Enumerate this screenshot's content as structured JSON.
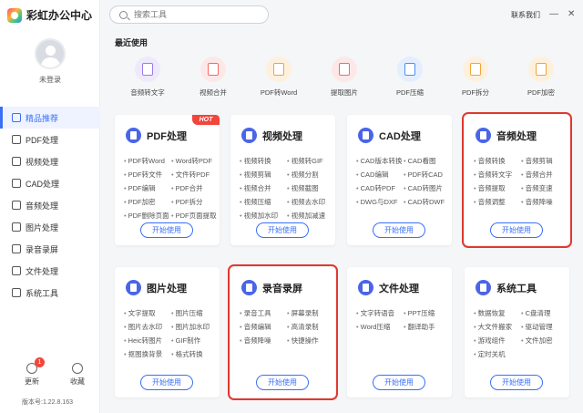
{
  "app": {
    "title": "彩虹办公中心",
    "version": "版本号:1.22.8.163"
  },
  "user": {
    "login_label": "未登录"
  },
  "search": {
    "placeholder": "搜索工具"
  },
  "header": {
    "contact": "联系我们",
    "minimize": "—",
    "close": "✕"
  },
  "sidebar": {
    "items": [
      {
        "label": "精品推荐",
        "icon": "thumbs-up-icon"
      },
      {
        "label": "PDF处理",
        "icon": "pdf-icon"
      },
      {
        "label": "视频处理",
        "icon": "video-icon"
      },
      {
        "label": "CAD处理",
        "icon": "cad-icon"
      },
      {
        "label": "音频处理",
        "icon": "music-icon"
      },
      {
        "label": "图片处理",
        "icon": "image-icon"
      },
      {
        "label": "录音录屏",
        "icon": "microphone-icon"
      },
      {
        "label": "文件处理",
        "icon": "folder-icon"
      },
      {
        "label": "系统工具",
        "icon": "monitor-icon"
      }
    ],
    "footer": {
      "update_label": "更新",
      "update_badge": "1",
      "favorite_label": "收藏"
    }
  },
  "recent": {
    "title": "最近使用",
    "items": [
      {
        "label": "音频转文字",
        "color": "#9b7bea",
        "bg": "#efe9fc"
      },
      {
        "label": "视频合并",
        "color": "#f06a6a",
        "bg": "#fde8e8"
      },
      {
        "label": "PDF转Word",
        "color": "#f0a43a",
        "bg": "#fdf1de"
      },
      {
        "label": "提取图片",
        "color": "#f06a6a",
        "bg": "#fde8e8"
      },
      {
        "label": "PDF压缩",
        "color": "#4a8ff0",
        "bg": "#e3efff"
      },
      {
        "label": "PDF拆分",
        "color": "#f0a43a",
        "bg": "#fdf1de"
      },
      {
        "label": "PDF加密",
        "color": "#f0a43a",
        "bg": "#fdf1de"
      }
    ]
  },
  "cards": [
    {
      "title": "PDF处理",
      "hot": "HOT",
      "button": "开始使用",
      "items": [
        "PDF转Word",
        "Word转PDF",
        "PDF转文件",
        "文件转PDF",
        "PDF编辑",
        "PDF合并",
        "PDF加密",
        "PDF拆分",
        "PDF删除页面",
        "PDF页面提取"
      ]
    },
    {
      "title": "视频处理",
      "button": "开始使用",
      "items": [
        "视频转换",
        "视频转GIF",
        "视频剪辑",
        "视频分割",
        "视频合并",
        "视频截图",
        "视频压缩",
        "视频去水印",
        "视频加水印",
        "视频加减速"
      ]
    },
    {
      "title": "CAD处理",
      "button": "开始使用",
      "items": [
        "CAD版本转换",
        "CAD看图",
        "CAD编辑",
        "PDF转CAD",
        "CAD转PDF",
        "CAD转图片",
        "DWG与DXF",
        "CAD转DWF"
      ]
    },
    {
      "title": "音频处理",
      "button": "开始使用",
      "items": [
        "音频转换",
        "音频剪辑",
        "音频转文字",
        "音频合并",
        "音频提取",
        "音频变速",
        "音频调整",
        "音频降噪"
      ]
    },
    {
      "title": "图片处理",
      "button": "开始使用",
      "items": [
        "文字提取",
        "图片压缩",
        "图片去水印",
        "图片加水印",
        "Heic转图片",
        "GIF制作",
        "抠图换背景",
        "格式转换"
      ]
    },
    {
      "title": "录音录屏",
      "button": "开始使用",
      "items": [
        "录音工具",
        "屏幕录制",
        "音频编辑",
        "高清录制",
        "音频降噪",
        "快捷操作"
      ]
    },
    {
      "title": "文件处理",
      "button": "开始使用",
      "items": [
        "文字转语音",
        "PPT压缩",
        "Word压缩",
        "翻译助手"
      ]
    },
    {
      "title": "系统工具",
      "button": "开始使用",
      "items": [
        "数据恢复",
        "C盘清理",
        "大文件搬家",
        "驱动管理",
        "游戏组件",
        "文件加密",
        "定时关机"
      ]
    }
  ]
}
